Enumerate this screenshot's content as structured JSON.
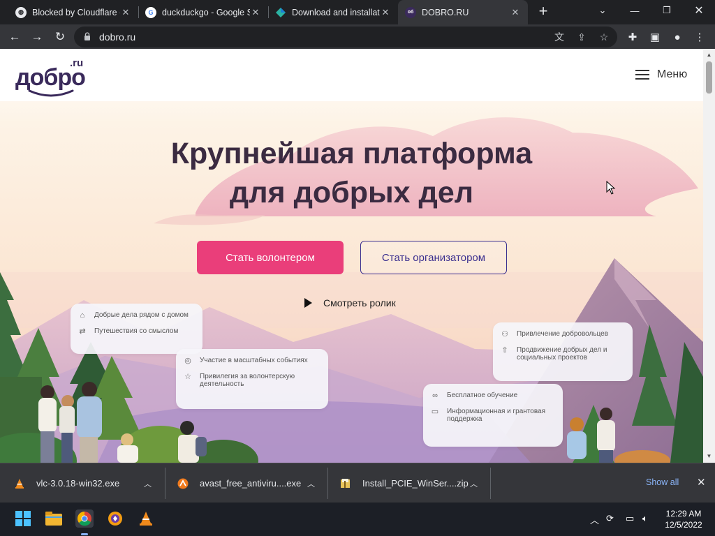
{
  "browser": {
    "tabs": [
      {
        "title": "Blocked by Cloudflare (",
        "favicon": "globe-icon"
      },
      {
        "title": "duckduckgo - Google S",
        "favicon": "google-icon"
      },
      {
        "title": "Download and installat",
        "favicon": "diamond-icon"
      },
      {
        "title": "DOBRO.RU",
        "favicon": "dobro-icon",
        "active": true
      }
    ],
    "url": "dobro.ru"
  },
  "site": {
    "logo_main": "добро",
    "logo_suffix": ".ru",
    "menu_label": "Меню",
    "hero_line1": "Крупнейшая платформа",
    "hero_line2": "для добрых дел",
    "btn_volunteer": "Стать волонтером",
    "btn_organizer": "Стать организатором",
    "video_label": "Смотреть ролик",
    "cards": [
      {
        "items": [
          {
            "icon": "home-icon",
            "text": "Добрые дела рядом с домом"
          },
          {
            "icon": "route-icon",
            "text": "Путешествия со смыслом"
          }
        ]
      },
      {
        "items": [
          {
            "icon": "globe-icon",
            "text": "Участие в масштабных событиях"
          },
          {
            "icon": "star-icon",
            "text": "Привилегия за волонтерскую деятельность"
          }
        ]
      },
      {
        "items": [
          {
            "icon": "people-icon",
            "text": "Привлечение добровольцев"
          },
          {
            "icon": "rocket-icon",
            "text": "Продвижение добрых дел и социальных проектов"
          }
        ]
      },
      {
        "items": [
          {
            "icon": "glasses-icon",
            "text": "Бесплатное обучение"
          },
          {
            "icon": "chat-icon",
            "text": "Информационная и грантовая поддержка"
          }
        ]
      }
    ],
    "colors": {
      "accent": "#ea3e7a",
      "brand": "#3a2a5b"
    }
  },
  "downloads": {
    "items": [
      {
        "name": "vlc-3.0.18-win32.exe",
        "icon": "vlc-icon"
      },
      {
        "name": "avast_free_antiviru....exe",
        "icon": "avast-icon"
      },
      {
        "name": "Install_PCIE_WinSer....zip",
        "icon": "zip-icon"
      }
    ],
    "show_all": "Show all"
  },
  "taskbar": {
    "time": "12:29 AM",
    "date": "12/5/2022"
  }
}
